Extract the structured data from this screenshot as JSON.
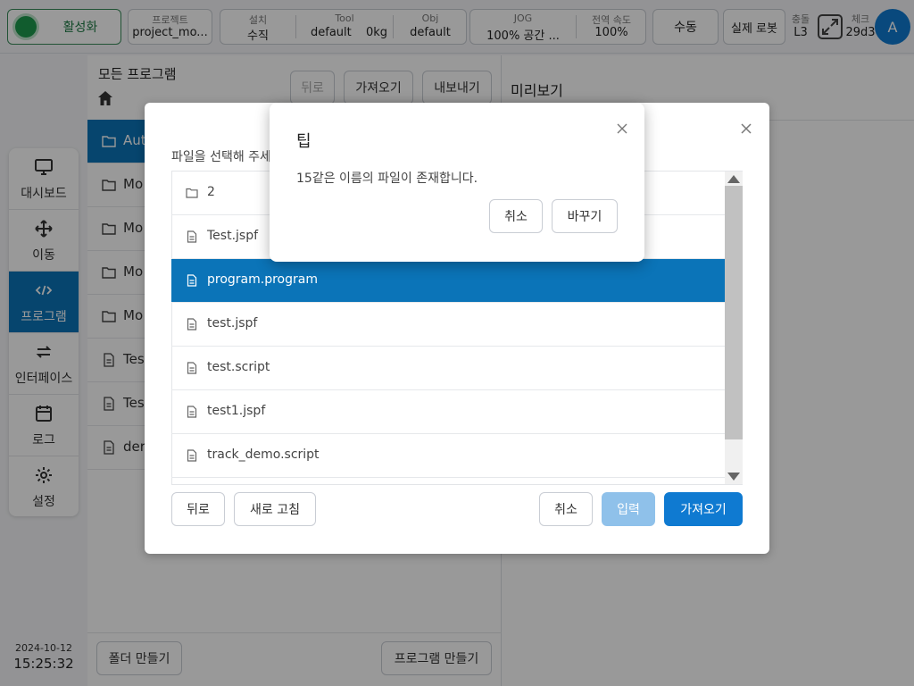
{
  "topbar": {
    "enable_label": "활성화",
    "project_label": "프로젝트",
    "project_value": "project_mo...",
    "install_label": "설치",
    "install_value": "수직",
    "tool_label": "Tool",
    "tool_value": "default",
    "tool_weight": "0kg",
    "obj_label": "Obj",
    "obj_value": "default",
    "jog_label": "JOG",
    "jog_value": "100%  공간 ...",
    "speed_label": "전역 속도",
    "speed_value": "100%",
    "manual_label": "수동",
    "real_robot_label": "실제 로봇",
    "collision_label": "충돌",
    "collision_value": "L3",
    "check_label": "체크",
    "check_value": "29d3",
    "avatar_letter": "A"
  },
  "nav": {
    "items": [
      {
        "label": "대시보드",
        "icon": "monitor-icon"
      },
      {
        "label": "이동",
        "icon": "move-icon"
      },
      {
        "label": "프로그램",
        "icon": "code-icon"
      },
      {
        "label": "인터페이스",
        "icon": "interface-icon"
      },
      {
        "label": "로그",
        "icon": "calendar-icon"
      },
      {
        "label": "설정",
        "icon": "gear-icon"
      }
    ]
  },
  "datetime": {
    "date": "2024-10-12",
    "time": "15:25:32"
  },
  "main": {
    "breadcrumb": "모든 프로그램",
    "back_label": "뒤로",
    "import_label": "가져오기",
    "export_label": "내보내기",
    "files": [
      {
        "name": "Aut",
        "type": "folder"
      },
      {
        "name": "Mo",
        "type": "folder"
      },
      {
        "name": "Mo",
        "type": "folder"
      },
      {
        "name": "Mo",
        "type": "folder"
      },
      {
        "name": "Mo",
        "type": "folder"
      },
      {
        "name": "Tes",
        "type": "file"
      },
      {
        "name": "Tes",
        "type": "file"
      },
      {
        "name": "der",
        "type": "file"
      }
    ],
    "new_folder_label": "폴더 만들기",
    "new_program_label": "프로그램 만들기"
  },
  "preview": {
    "title": "미리보기"
  },
  "import_dialog": {
    "title": "파일을 선택해 주세",
    "files": [
      {
        "name": "2",
        "type": "folder"
      },
      {
        "name": "Test.jspf",
        "type": "file"
      },
      {
        "name": "program.program",
        "type": "file"
      },
      {
        "name": "test.jspf",
        "type": "file"
      },
      {
        "name": "test.script",
        "type": "file"
      },
      {
        "name": "test1.jspf",
        "type": "file"
      },
      {
        "name": "track_demo.script",
        "type": "file"
      }
    ],
    "back_label": "뒤로",
    "refresh_label": "새로 고침",
    "cancel_label": "취소",
    "enter_label": "입력",
    "import_label": "가져오기"
  },
  "tip_modal": {
    "title": "팁",
    "message": "15같은 이름의 파일이 존재합니다.",
    "cancel_label": "취소",
    "replace_label": "바꾸기"
  },
  "colors": {
    "accent": "#0b74b8",
    "primary": "#0f7ad1",
    "enable": "#1d9a4e"
  }
}
